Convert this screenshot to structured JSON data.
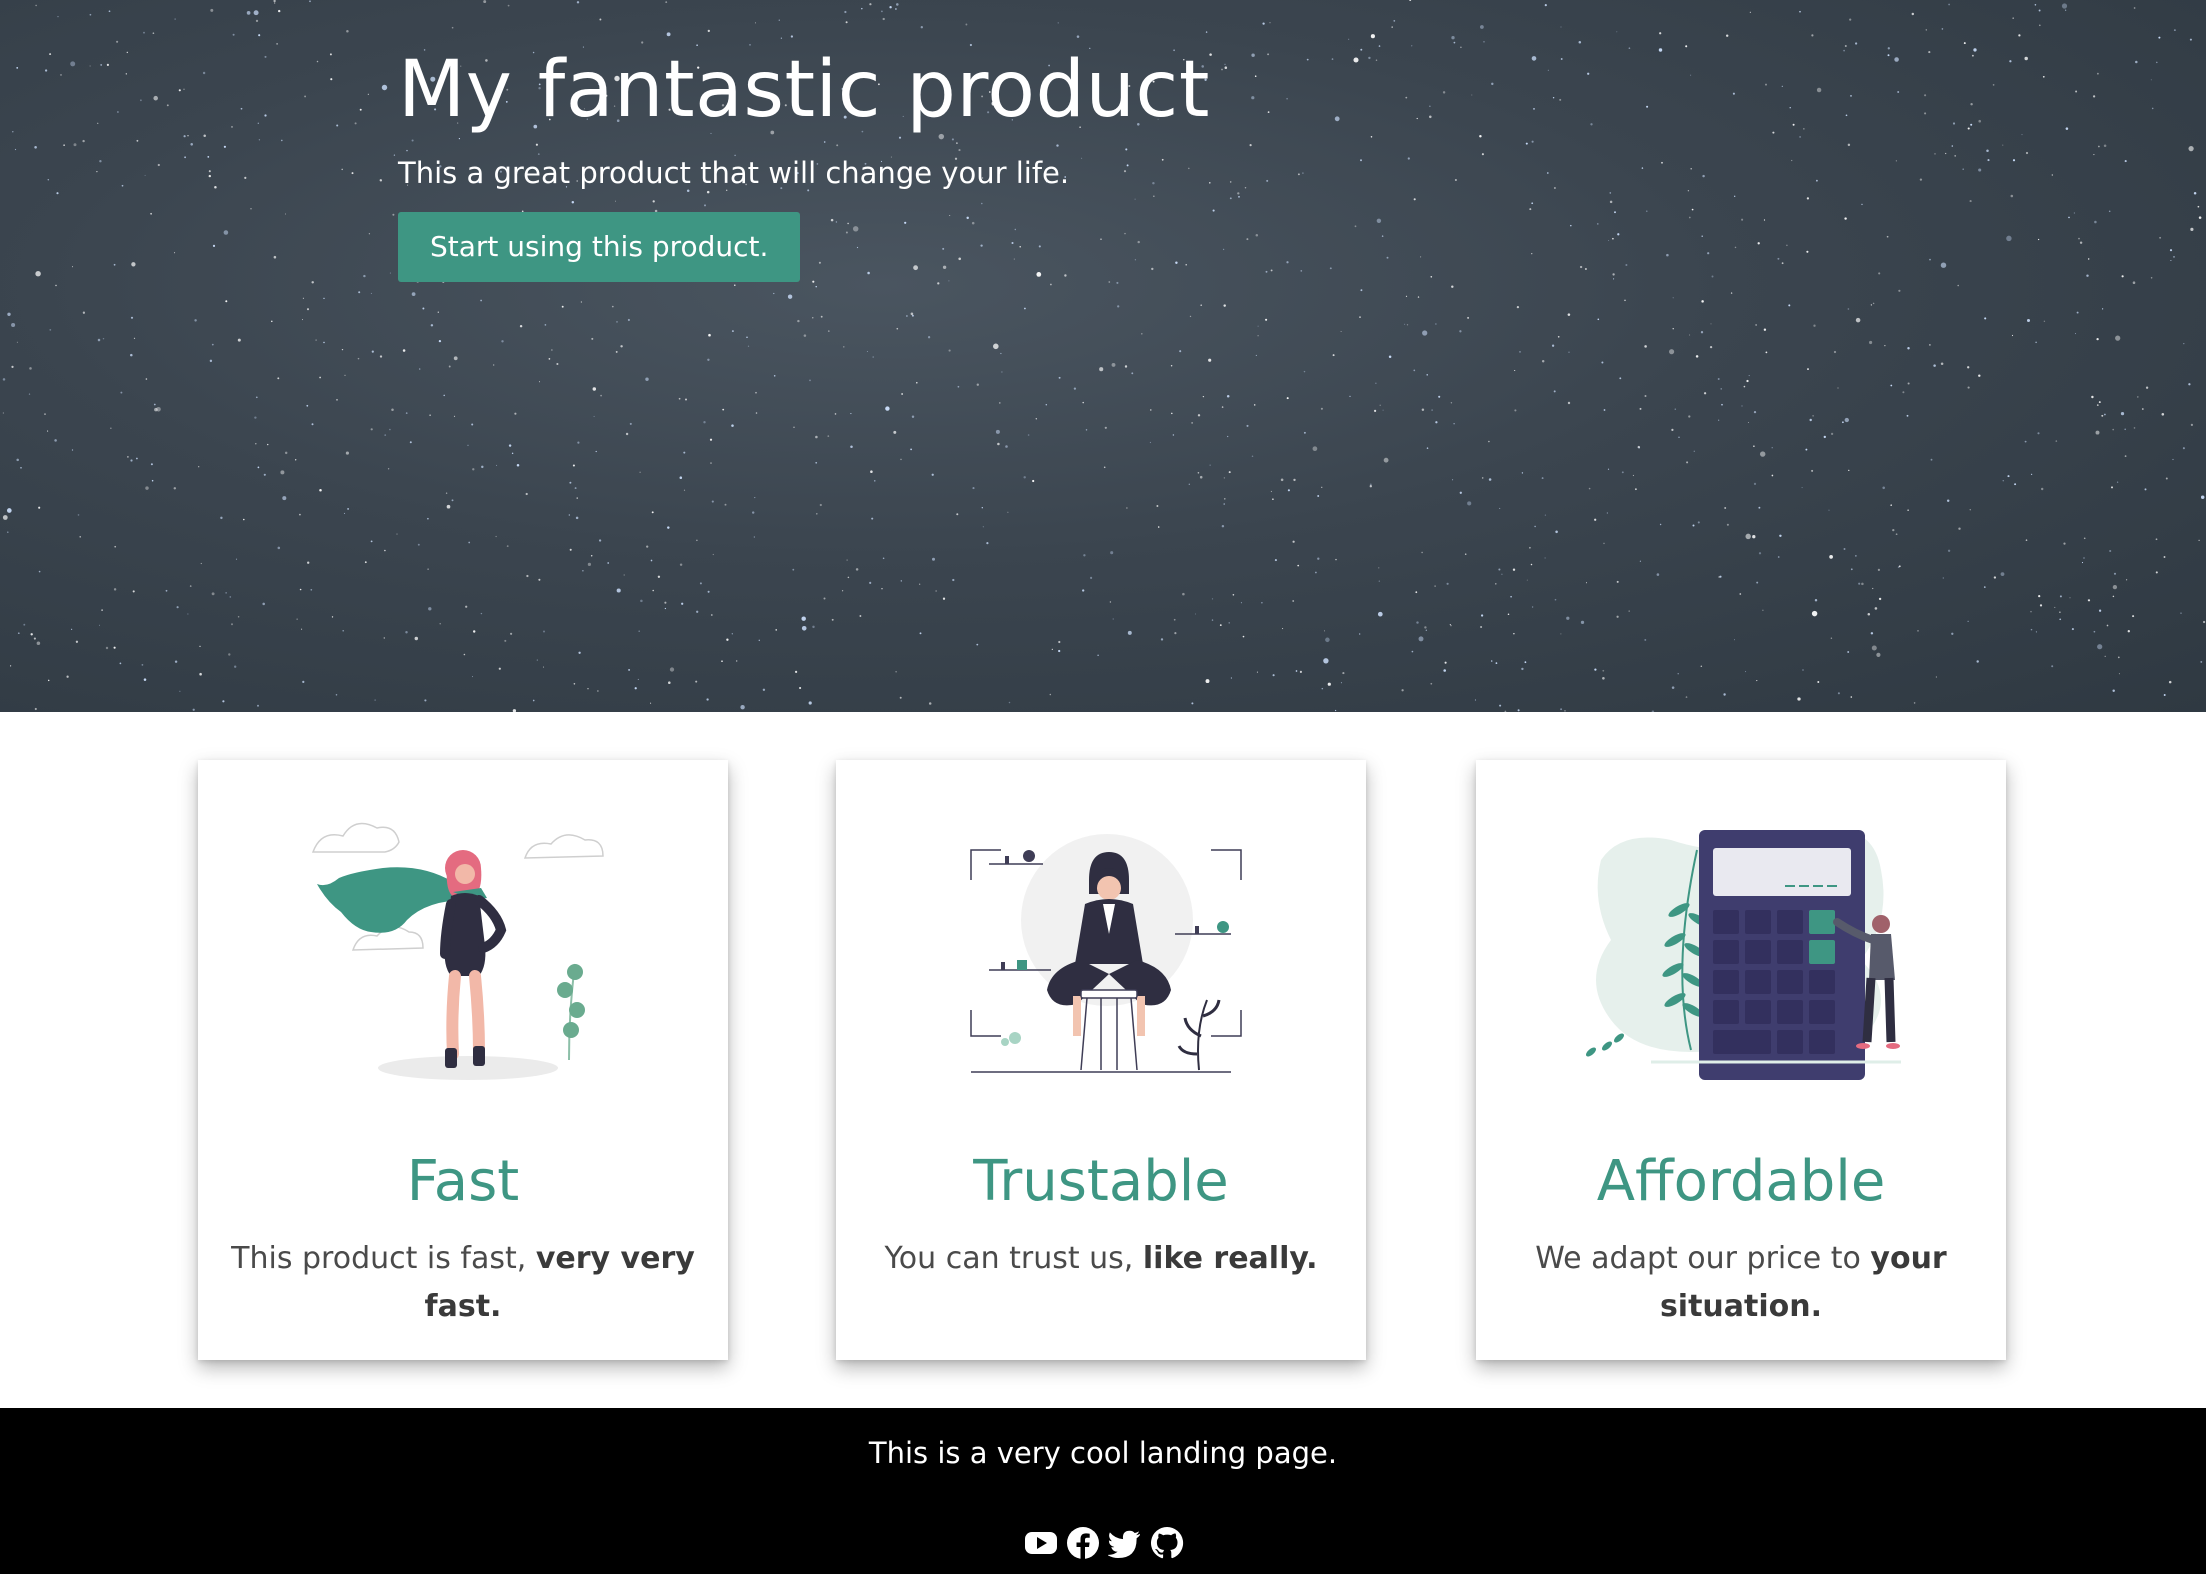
{
  "hero": {
    "title": "My fantastic product",
    "subtitle": "This a great product that will change your life.",
    "cta_label": "Start using this product."
  },
  "features": [
    {
      "title": "Fast",
      "text_regular": "This product is fast, ",
      "text_bold": "very very fast.",
      "illustration": "superwoman-illustration"
    },
    {
      "title": "Trustable",
      "text_regular": "You can trust us, ",
      "text_bold": "like really.",
      "illustration": "woman-on-stool-illustration"
    },
    {
      "title": "Affordable",
      "text_regular": "We adapt our price to ",
      "text_bold": "your situation.",
      "illustration": "calculator-illustration"
    }
  ],
  "footer": {
    "text": "This is a very cool landing page.",
    "social_icons": [
      "youtube-icon",
      "facebook-icon",
      "twitter-icon",
      "github-icon"
    ]
  },
  "colors": {
    "accent": "#3e9683",
    "hero_background": "#3b454f",
    "footer_background": "#000000",
    "illustration_dark": "#2f2e41",
    "illustration_pink": "#e46b80"
  }
}
